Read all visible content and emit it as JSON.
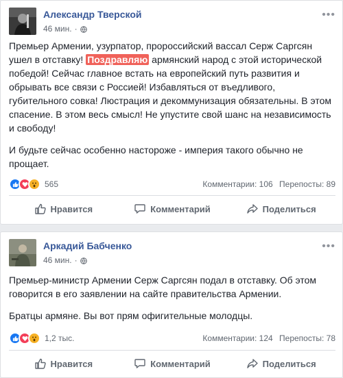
{
  "posts": [
    {
      "author": "Александр Тверской",
      "time": "46 мин.",
      "paragraph1_a": "Премьер Армении, узурпатор, пророссийский вассал Серж Саргсян ушел в отставку! ",
      "paragraph1_highlight": "Поздравляю",
      "paragraph1_b": " армянский народ с этой исторической победой! Сейчас главное встать на европейский путь развития и обрывать все связи с Россией! Избавляться от въедливого, губительного совка! Люстрация и декоммунизация обязательны. В этом спасение. В этом весь смысл! Не упустите свой шанс на независимость и свободу!",
      "paragraph2": "И будьте сейчас особенно настороже - империя такого обычно не прощает.",
      "reactions_count": "565",
      "comments": "Комментарии: 106",
      "shares": "Перепосты: 89"
    },
    {
      "author": "Аркадий Бабченко",
      "time": "46 мин.",
      "paragraph1": "Премьер-министр Армении Серж Саргсян подал в отставку. Об этом говорится в его заявлении на сайте правительства Армении.",
      "paragraph2": "Братцы армяне. Вы вот прям офигительные молодцы.",
      "reactions_count": "1,2 тыс.",
      "comments": "Комментарии: 124",
      "shares": "Перепосты: 78"
    }
  ],
  "actions": {
    "like": "Нравится",
    "comment": "Комментарий",
    "share": "Поделиться"
  },
  "colors": {
    "author": "#385898",
    "highlight": "#f0625a",
    "like_reaction": "#1877f2",
    "love_reaction": "#f33e58",
    "wow_reaction": "#f7b125"
  },
  "icons": [
    "globe-icon",
    "more-icon",
    "like-reaction-icon",
    "love-reaction-icon",
    "wow-reaction-icon",
    "thumbs-up-icon",
    "comment-icon",
    "share-icon"
  ]
}
